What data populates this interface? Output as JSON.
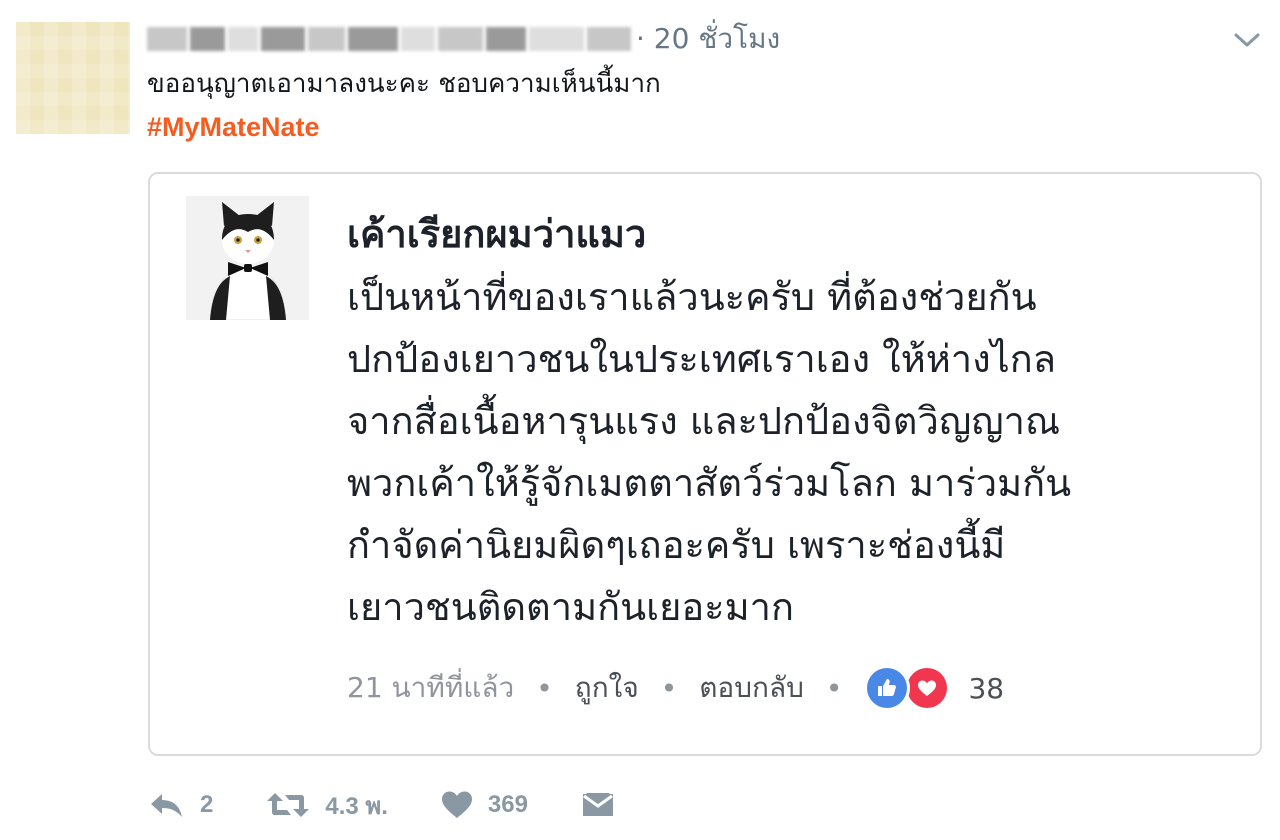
{
  "tweet": {
    "time": "· 20 ชั่วโมง",
    "text": "ขออนุญาตเอามาลงนะคะ ชอบความเห็นนี้มาก",
    "hashtag": "#MyMateNate"
  },
  "comment": {
    "author": "เค้าเรียกผมว่าแมว",
    "lines": [
      "เป็นหน้าที่ของเราแล้วนะครับ ที่ต้องช่วยกัน",
      "ปกป้องเยาวชนในประเทศเราเอง ให้ห่างไกล",
      "จากสื่อเนื้อหารุนแรง และปกป้องจิตวิญญาณ",
      "พวกเค้าให้รู้จักเมตตาสัตว์ร่วมโลก มาร่วมกัน",
      "กำจัดค่านิยมผิดๆเถอะครับ เพราะช่องนี้มี",
      "เยาวชนติดตามกันเยอะมาก"
    ],
    "time": "21 นาทีที่แล้ว",
    "like_label": "ถูกใจ",
    "reply_label": "ตอบกลับ",
    "reaction_count": "38",
    "separator": "•"
  },
  "actions": {
    "reply_count": "2",
    "retweet_count": "4.3 พ.",
    "like_count": "369"
  },
  "colors": {
    "hashtag": "#f45d22",
    "like_reaction": "#4a88e8",
    "love_reaction": "#f0374f",
    "muted": "#657786"
  },
  "icons": [
    "chevron-down-icon",
    "like-reaction-icon",
    "love-reaction-icon",
    "reply-icon",
    "retweet-icon",
    "heart-icon",
    "direct-message-icon"
  ]
}
